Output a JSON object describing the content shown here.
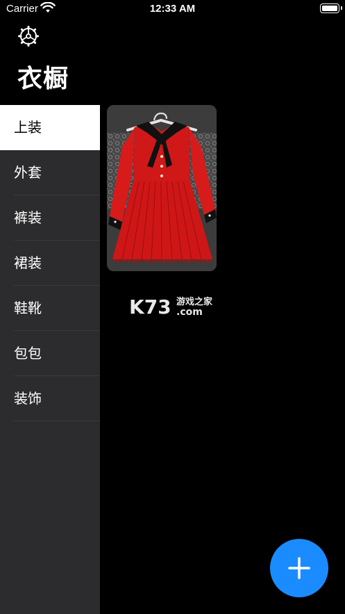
{
  "status_bar": {
    "carrier": "Carrier",
    "time": "12:33 AM",
    "icons": [
      "wifi-icon",
      "battery-icon"
    ]
  },
  "header": {
    "settings_icon": "gear-icon",
    "title": "衣橱"
  },
  "sidebar": {
    "selected_index": 0,
    "items": [
      {
        "label": "上装",
        "active": true
      },
      {
        "label": "外套",
        "active": false
      },
      {
        "label": "裤装",
        "active": false
      },
      {
        "label": "裙装",
        "active": false
      },
      {
        "label": "鞋靴",
        "active": false
      },
      {
        "label": "包包",
        "active": false
      },
      {
        "label": "装饰",
        "active": false
      }
    ]
  },
  "main": {
    "items": [
      {
        "image": "red-pleated-dress-with-black-bow"
      }
    ]
  },
  "watermark": {
    "logo": "K73",
    "text_top": "游戏之家",
    "text_bottom": ".com"
  },
  "fab": {
    "icon": "plus-icon"
  },
  "colors": {
    "background": "#000000",
    "sidebar": "#2c2c2e",
    "sidebar_active": "#ffffff",
    "accent": "#1a8cff",
    "dress": "#d71b1b"
  }
}
